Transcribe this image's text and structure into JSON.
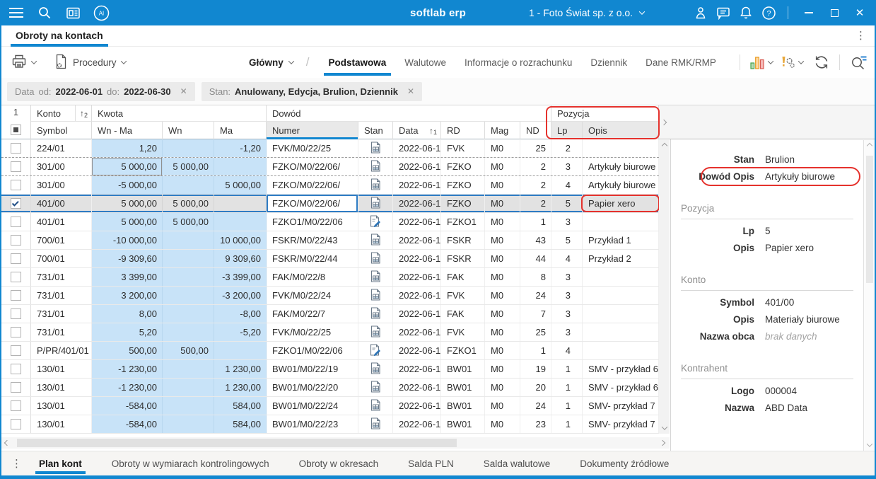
{
  "titlebar": {
    "app_title": "softlab erp",
    "company_selector": "1 - Foto Świat sp. z o.o."
  },
  "doc_tabs": {
    "active": "Obroty na kontach"
  },
  "toolbar": {
    "procedures_label": "Procedury",
    "view_menu": "Główny",
    "tabs": [
      {
        "label": "Podstawowa",
        "active": true
      },
      {
        "label": "Walutowe",
        "active": false
      },
      {
        "label": "Informacje o rozrachunku",
        "active": false
      },
      {
        "label": "Dziennik",
        "active": false
      },
      {
        "label": "Dane RMK/RMP",
        "active": false
      }
    ]
  },
  "filter_chips": [
    {
      "segments": [
        {
          "kind": "lbl",
          "text": "Data"
        },
        {
          "kind": "lbl",
          "text": "od:"
        },
        {
          "kind": "val",
          "text": "2022-06-01"
        },
        {
          "kind": "lbl",
          "text": "do:"
        },
        {
          "kind": "val",
          "text": "2022-06-30"
        }
      ]
    },
    {
      "segments": [
        {
          "kind": "lbl",
          "text": "Stan:"
        },
        {
          "kind": "val",
          "text": "Anulowany, Edycja, Brulion, Dziennik"
        }
      ]
    }
  ],
  "grid": {
    "row_number": "1",
    "groups": {
      "konto": "Konto",
      "kwota": "Kwota",
      "dowod": "Dowód",
      "pozycja": "Pozycja"
    },
    "sort": {
      "konto_arrow": "↑",
      "konto_order": "2",
      "data_arrow": "↑",
      "data_order": "1"
    },
    "columns": {
      "symbol": "Symbol",
      "wn_ma": "Wn - Ma",
      "wn": "Wn",
      "ma": "Ma",
      "numer": "Numer",
      "stan": "Stan",
      "data": "Data",
      "rd": "RD",
      "mag": "Mag",
      "nd": "ND",
      "lp": "Lp",
      "opis": "Opis"
    },
    "rows": [
      {
        "checked": false,
        "symbol": "224/01",
        "wn_ma": "1,20",
        "wn": "",
        "ma": "-1,20",
        "numer": "FVK/M0/22/25",
        "stan_icon": "doc-grid-icon",
        "data": "2022-06-1",
        "rd": "FVK",
        "mag": "M0",
        "nd": "25",
        "lp": "2",
        "opis": "",
        "dashed": true,
        "selected": false,
        "wn_focus": false,
        "numer_focus": false,
        "opis_annotated": false
      },
      {
        "checked": false,
        "symbol": "301/00",
        "wn_ma": "5 000,00",
        "wn": "5 000,00",
        "ma": "",
        "numer": "FZKO/M0/22/06/",
        "stan_icon": "doc-grid-icon",
        "data": "2022-06-1",
        "rd": "FZKO",
        "mag": "M0",
        "nd": "2",
        "lp": "3",
        "opis": "Artykuły biurowe",
        "dashed": true,
        "selected": false,
        "wn_focus": true,
        "numer_focus": false,
        "opis_annotated": false
      },
      {
        "checked": false,
        "symbol": "301/00",
        "wn_ma": "-5 000,00",
        "wn": "",
        "ma": "5 000,00",
        "numer": "FZKO/M0/22/06/",
        "stan_icon": "doc-grid-icon",
        "data": "2022-06-1",
        "rd": "FZKO",
        "mag": "M0",
        "nd": "2",
        "lp": "4",
        "opis": "Artykuły biurowe",
        "dashed": false,
        "selected": false,
        "wn_focus": false,
        "numer_focus": false,
        "opis_annotated": false
      },
      {
        "checked": true,
        "symbol": "401/00",
        "wn_ma": "5 000,00",
        "wn": "5 000,00",
        "ma": "",
        "numer": "FZKO/M0/22/06/",
        "stan_icon": "doc-grid-icon",
        "data": "2022-06-1",
        "rd": "FZKO",
        "mag": "M0",
        "nd": "2",
        "lp": "5",
        "opis": "Papier xero",
        "dashed": false,
        "selected": true,
        "wn_focus": false,
        "numer_focus": true,
        "opis_annotated": true
      },
      {
        "checked": false,
        "symbol": "401/01",
        "wn_ma": "5 000,00",
        "wn": "5 000,00",
        "ma": "",
        "numer": "FZKO1/M0/22/06",
        "stan_icon": "doc-edit-icon",
        "data": "2022-06-1",
        "rd": "FZKO1",
        "mag": "M0",
        "nd": "1",
        "lp": "3",
        "opis": "",
        "dashed": false,
        "selected": false,
        "wn_focus": false,
        "numer_focus": false,
        "opis_annotated": false
      },
      {
        "checked": false,
        "symbol": "700/01",
        "wn_ma": "-10 000,00",
        "wn": "",
        "ma": "10 000,00",
        "numer": "FSKR/M0/22/43",
        "stan_icon": "doc-grid-icon",
        "data": "2022-06-1",
        "rd": "FSKR",
        "mag": "M0",
        "nd": "43",
        "lp": "5",
        "opis": "Przykład 1",
        "dashed": false,
        "selected": false,
        "wn_focus": false,
        "numer_focus": false,
        "opis_annotated": false
      },
      {
        "checked": false,
        "symbol": "700/01",
        "wn_ma": "-9 309,60",
        "wn": "",
        "ma": "9 309,60",
        "numer": "FSKR/M0/22/44",
        "stan_icon": "doc-grid-icon",
        "data": "2022-06-1",
        "rd": "FSKR",
        "mag": "M0",
        "nd": "44",
        "lp": "4",
        "opis": "Przykład 2",
        "dashed": false,
        "selected": false,
        "wn_focus": false,
        "numer_focus": false,
        "opis_annotated": false
      },
      {
        "checked": false,
        "symbol": "731/01",
        "wn_ma": "3 399,00",
        "wn": "",
        "ma": "-3 399,00",
        "numer": "FAK/M0/22/8",
        "stan_icon": "doc-grid-icon",
        "data": "2022-06-1",
        "rd": "FAK",
        "mag": "M0",
        "nd": "8",
        "lp": "3",
        "opis": "",
        "dashed": false,
        "selected": false,
        "wn_focus": false,
        "numer_focus": false,
        "opis_annotated": false
      },
      {
        "checked": false,
        "symbol": "731/01",
        "wn_ma": "3 200,00",
        "wn": "",
        "ma": "-3 200,00",
        "numer": "FVK/M0/22/24",
        "stan_icon": "doc-grid-icon",
        "data": "2022-06-1",
        "rd": "FVK",
        "mag": "M0",
        "nd": "24",
        "lp": "3",
        "opis": "",
        "dashed": false,
        "selected": false,
        "wn_focus": false,
        "numer_focus": false,
        "opis_annotated": false
      },
      {
        "checked": false,
        "symbol": "731/01",
        "wn_ma": "8,00",
        "wn": "",
        "ma": "-8,00",
        "numer": "FAK/M0/22/7",
        "stan_icon": "doc-grid-icon",
        "data": "2022-06-1",
        "rd": "FAK",
        "mag": "M0",
        "nd": "7",
        "lp": "3",
        "opis": "",
        "dashed": false,
        "selected": false,
        "wn_focus": false,
        "numer_focus": false,
        "opis_annotated": false
      },
      {
        "checked": false,
        "symbol": "731/01",
        "wn_ma": "5,20",
        "wn": "",
        "ma": "-5,20",
        "numer": "FVK/M0/22/25",
        "stan_icon": "doc-grid-icon",
        "data": "2022-06-1",
        "rd": "FVK",
        "mag": "M0",
        "nd": "25",
        "lp": "3",
        "opis": "",
        "dashed": false,
        "selected": false,
        "wn_focus": false,
        "numer_focus": false,
        "opis_annotated": false
      },
      {
        "checked": false,
        "symbol": "P/PR/401/01",
        "wn_ma": "500,00",
        "wn": "500,00",
        "ma": "",
        "numer": "FZKO1/M0/22/06",
        "stan_icon": "doc-edit-icon",
        "data": "2022-06-1",
        "rd": "FZKO1",
        "mag": "M0",
        "nd": "1",
        "lp": "4",
        "opis": "",
        "dashed": false,
        "selected": false,
        "wn_focus": false,
        "numer_focus": false,
        "opis_annotated": false
      },
      {
        "checked": false,
        "symbol": "130/01",
        "wn_ma": "-1 230,00",
        "wn": "",
        "ma": "1 230,00",
        "numer": "BW01/M0/22/19",
        "stan_icon": "doc-grid-icon",
        "data": "2022-06-1",
        "rd": "BW01",
        "mag": "M0",
        "nd": "19",
        "lp": "1",
        "opis": "SMV - przykład 6",
        "dashed": false,
        "selected": false,
        "wn_focus": false,
        "numer_focus": false,
        "opis_annotated": false
      },
      {
        "checked": false,
        "symbol": "130/01",
        "wn_ma": "-1 230,00",
        "wn": "",
        "ma": "1 230,00",
        "numer": "BW01/M0/22/20",
        "stan_icon": "doc-grid-icon",
        "data": "2022-06-1",
        "rd": "BW01",
        "mag": "M0",
        "nd": "20",
        "lp": "1",
        "opis": "SMV - przykład 6",
        "dashed": false,
        "selected": false,
        "wn_focus": false,
        "numer_focus": false,
        "opis_annotated": false
      },
      {
        "checked": false,
        "symbol": "130/01",
        "wn_ma": "-584,00",
        "wn": "",
        "ma": "584,00",
        "numer": "BW01/M0/22/24",
        "stan_icon": "doc-grid-icon",
        "data": "2022-06-1",
        "rd": "BW01",
        "mag": "M0",
        "nd": "24",
        "lp": "1",
        "opis": "SMV- przykład 7",
        "dashed": false,
        "selected": false,
        "wn_focus": false,
        "numer_focus": false,
        "opis_annotated": false
      },
      {
        "checked": false,
        "symbol": "130/01",
        "wn_ma": "-584,00",
        "wn": "",
        "ma": "584,00",
        "numer": "BW01/M0/22/23",
        "stan_icon": "doc-grid-icon",
        "data": "2022-06-1",
        "rd": "BW01",
        "mag": "M0",
        "nd": "23",
        "lp": "1",
        "opis": "SMV- przykład 7",
        "dashed": false,
        "selected": false,
        "wn_focus": false,
        "numer_focus": false,
        "opis_annotated": false
      }
    ]
  },
  "detail_panel": {
    "top_fields": [
      {
        "label": "Stan",
        "value": "Brulion",
        "annotated": false,
        "muted": false
      },
      {
        "label": "Dowód Opis",
        "value": "Artykuły biurowe",
        "annotated": true,
        "muted": false
      }
    ],
    "sections": [
      {
        "title": "Pozycja",
        "fields": [
          {
            "label": "Lp",
            "value": "5",
            "muted": false
          },
          {
            "label": "Opis",
            "value": "Papier xero",
            "muted": false
          }
        ]
      },
      {
        "title": "Konto",
        "fields": [
          {
            "label": "Symbol",
            "value": "401/00",
            "muted": false
          },
          {
            "label": "Opis",
            "value": "Materiały biurowe",
            "muted": false
          },
          {
            "label": "Nazwa obca",
            "value": "brak danych",
            "muted": true
          }
        ]
      },
      {
        "title": "Kontrahent",
        "fields": [
          {
            "label": "Logo",
            "value": "000004",
            "muted": false
          },
          {
            "label": "Nazwa",
            "value": "ABD Data",
            "muted": false
          }
        ]
      }
    ]
  },
  "bottom_tabs": [
    {
      "label": "Plan kont",
      "active": true
    },
    {
      "label": "Obroty w wymiarach kontrolingowych",
      "active": false
    },
    {
      "label": "Obroty w okresach",
      "active": false
    },
    {
      "label": "Salda PLN",
      "active": false
    },
    {
      "label": "Salda walutowe",
      "active": false
    },
    {
      "label": "Dokumenty źródłowe",
      "active": false
    }
  ]
}
